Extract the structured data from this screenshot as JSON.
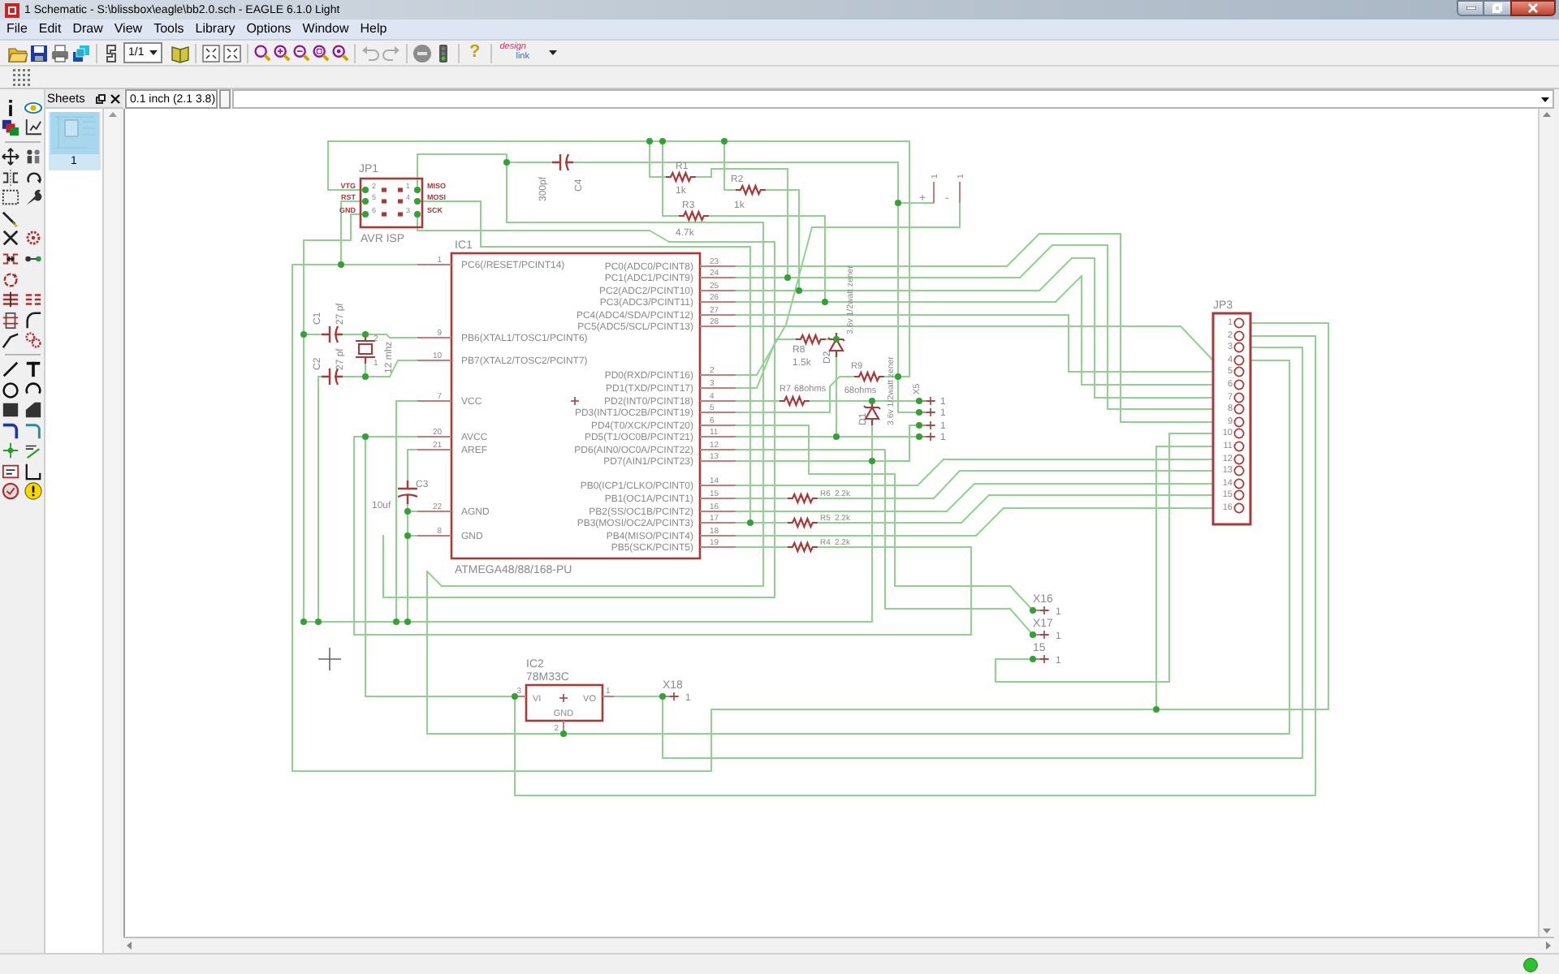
{
  "window": {
    "title": "1 Schematic - S:\\blissbox\\eagle\\bb2.0.sch - EAGLE 6.1.0 Light"
  },
  "menu": [
    "File",
    "Edit",
    "Draw",
    "View",
    "Tools",
    "Library",
    "Options",
    "Window",
    "Help"
  ],
  "toolbar": {
    "sheet_select": "1/1",
    "help": "?",
    "logo": {
      "top": "design",
      "bottom": "link"
    }
  },
  "sheets_panel": {
    "title": "Sheets",
    "sheets": [
      {
        "label": "1",
        "selected": true
      }
    ]
  },
  "command_bar": {
    "coordinates": "0.1 inch (2.1 3.8)"
  },
  "schematic": {
    "ic1": {
      "name": "IC1",
      "value": "ATMEGA48/88/168-PU",
      "left_pins": [
        {
          "number": "1",
          "name": "PC6(/RESET/PCINT14)"
        },
        {
          "number": "9",
          "name": "PB6(XTAL1/TOSC1/PCINT6)"
        },
        {
          "number": "10",
          "name": "PB7(XTAL2/TOSC2/PCINT7)"
        },
        {
          "number": "7",
          "name": "VCC"
        },
        {
          "number": "20",
          "name": "AVCC"
        },
        {
          "number": "21",
          "name": "AREF"
        },
        {
          "number": "22",
          "name": "AGND"
        },
        {
          "number": "8",
          "name": "GND"
        }
      ],
      "right_pins": [
        {
          "number": "23",
          "name": "PC0(ADC0/PCINT8)"
        },
        {
          "number": "24",
          "name": "PC1(ADC1/PCINT9)"
        },
        {
          "number": "25",
          "name": "PC2(ADC2/PCINT10)"
        },
        {
          "number": "26",
          "name": "PC3(ADC3/PCINT11)"
        },
        {
          "number": "27",
          "name": "PC4(ADC4/SDA/PCINT12)"
        },
        {
          "number": "28",
          "name": "PC5(ADC5/SCL/PCINT13)"
        },
        {
          "number": "2",
          "name": "PD0(RXD/PCINT16)"
        },
        {
          "number": "3",
          "name": "PD1(TXD/PCINT17)"
        },
        {
          "number": "4",
          "name": "PD2(INT0/PCINT18)"
        },
        {
          "number": "5",
          "name": "PD3(INT1/OC2B/PCINT19)"
        },
        {
          "number": "6",
          "name": "PD4(T0/XCK/PCINT20)"
        },
        {
          "number": "11",
          "name": "PD5(T1/OC0B/PCINT21)"
        },
        {
          "number": "12",
          "name": "PD6(AIN0/OC0A/PCINT22)"
        },
        {
          "number": "13",
          "name": "PD7(AIN1/PCINT23)"
        },
        {
          "number": "14",
          "name": "PB0(ICP1/CLKO/PCINT0)"
        },
        {
          "number": "15",
          "name": "PB1(OC1A/PCINT1)"
        },
        {
          "number": "16",
          "name": "PB2(SS/OC1B/PCINT2)"
        },
        {
          "number": "17",
          "name": "PB3(MOSI/OC2A/PCINT3)"
        },
        {
          "number": "18",
          "name": "PB4(MISO/PCINT4)"
        },
        {
          "number": "19",
          "name": "PB5(SCK/PCINT5)"
        }
      ]
    },
    "jp1": {
      "name": "JP1",
      "value": "AVR ISP",
      "rows": [
        {
          "left_signal": "VTG",
          "left_pad": "2",
          "right_pad": "1",
          "right_signal": "MISO"
        },
        {
          "left_signal": "RST",
          "left_pad": "5",
          "right_pad": "4",
          "right_signal": "MOSI"
        },
        {
          "left_signal": "GND",
          "left_pad": "6",
          "right_pad": "3",
          "right_signal": "SCK"
        }
      ]
    },
    "components": [
      {
        "kind": "resistor",
        "name": "R1",
        "value": "1k"
      },
      {
        "kind": "resistor",
        "name": "R2",
        "value": "1k"
      },
      {
        "kind": "resistor",
        "name": "R3",
        "value": "4.7k"
      },
      {
        "kind": "capacitor",
        "name": "C4",
        "value": "300pf"
      },
      {
        "kind": "capacitor",
        "name": "C1",
        "value": "27 pf"
      },
      {
        "kind": "capacitor",
        "name": "C2",
        "value": "27 pf"
      },
      {
        "kind": "crystal",
        "value": "12 mhz",
        "pins": [
          "2",
          "1"
        ]
      },
      {
        "kind": "capacitor",
        "name": "C3",
        "value": "10uf"
      },
      {
        "kind": "resistor",
        "name": "R8",
        "value": "1.5k"
      },
      {
        "kind": "zener",
        "name": "D2",
        "value": "3.6v 1/2watt zener"
      },
      {
        "kind": "resistor",
        "name": "R7",
        "value": "68ohms"
      },
      {
        "kind": "resistor",
        "name": "R9",
        "value": "68ohms"
      },
      {
        "kind": "zener",
        "name": "D1",
        "value": "3.6v 1/2watt zener"
      },
      {
        "kind": "resistor",
        "name": "R6",
        "value": "2.2k"
      },
      {
        "kind": "resistor",
        "name": "R5",
        "value": "2.2k"
      },
      {
        "kind": "resistor",
        "name": "R4",
        "value": "2.2k"
      }
    ],
    "supply_pins": [
      {
        "label": "+",
        "number": "1"
      },
      {
        "label": "-",
        "number": "1"
      }
    ],
    "usb_pins": {
      "name": "X5",
      "numbers": [
        "1",
        "1",
        "1",
        "1"
      ]
    },
    "jp3": {
      "name": "JP3",
      "pin_numbers": [
        "1",
        "2",
        "3",
        "4",
        "5",
        "6",
        "7",
        "8",
        "9",
        "10",
        "11",
        "12",
        "13",
        "14",
        "15",
        "16"
      ]
    },
    "ic2": {
      "name": "IC2",
      "value": "78M33C",
      "pins": [
        {
          "number": "3",
          "name": "VI"
        },
        {
          "number": "1",
          "name": "VO"
        },
        {
          "number": "2",
          "name": "GND"
        }
      ]
    },
    "pads": [
      {
        "name": "X16",
        "number": "1"
      },
      {
        "name": "X17",
        "number": "1"
      },
      {
        "name": "15",
        "number": "1"
      },
      {
        "name": "X18",
        "number": "1"
      }
    ]
  }
}
